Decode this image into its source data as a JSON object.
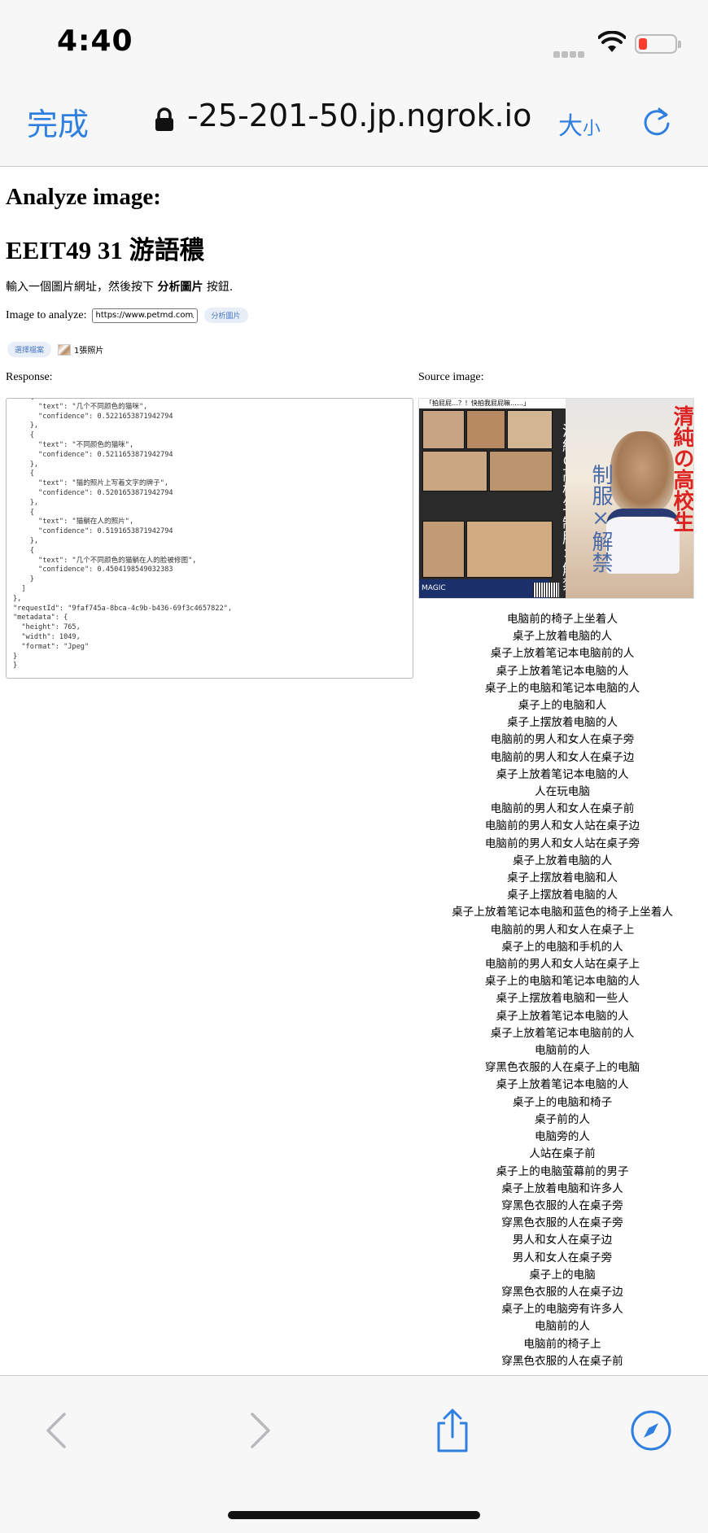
{
  "status_bar": {
    "time": "4:40"
  },
  "browser": {
    "done_label": "完成",
    "url": "-25-201-50.jp.ngrok.io",
    "text_size_big": "大",
    "text_size_small": "小"
  },
  "page": {
    "heading": "Analyze image:",
    "student": "EEIT49 31 游語穠",
    "intro_prefix": "輸入一個圖片網址，然後按下 ",
    "intro_bold": "分析圖片",
    "intro_suffix": " 按鈕.",
    "image_label": "Image to analyze:",
    "url_value": "https://www.petmd.com/sites/default/files/",
    "analyze_button": "分析圖片",
    "choose_file_button": "選擇檔案",
    "file_count": "1張照片",
    "response_label": "Response:",
    "source_label": "Source image:"
  },
  "response_json": [
    "    {",
    "      \"text\": \"几个不同颜色的猫咪\",",
    "      \"confidence\": 0.5221653871942794",
    "    },",
    "    {",
    "      \"text\": \"不同颜色的猫咪\",",
    "      \"confidence\": 0.5211653871942794",
    "    },",
    "    {",
    "      \"text\": \"猫的照片上写着文字的牌子\",",
    "      \"confidence\": 0.5201653871942794",
    "    },",
    "    {",
    "      \"text\": \"猫躺在人的照片\",",
    "      \"confidence\": 0.5191653871942794",
    "    },",
    "    {",
    "      \"text\": \"几个不同颜色的猫躺在人的脸被修图\",",
    "      \"confidence\": 0.4504198549032383",
    "    }",
    "  ]",
    "},",
    "\"requestId\": \"9faf745a-8bca-4c9b-b436-69f3c4657822\",",
    "\"metadata\": {",
    "  \"height\": 765,",
    "  \"width\": 1049,",
    "  \"format\": \"Jpeg\"",
    "}",
    "}"
  ],
  "poster_text": {
    "top_strip": "「拍屁屁…？！快拍我屁屁嘛……」",
    "vertical_white": "清純の高校生 制服×解禁",
    "red_title": "清純の高校生",
    "blue_title": "制服×解禁",
    "brand": "MAGIC"
  },
  "captions": [
    "电脑前的椅子上坐着人",
    "桌子上放着电脑的人",
    "桌子上放着笔记本电脑前的人",
    "桌子上放着笔记本电脑的人",
    "桌子上的电脑和笔记本电脑的人",
    "桌子上的电脑和人",
    "桌子上摆放着电脑的人",
    "电脑前的男人和女人在桌子旁",
    "电脑前的男人和女人在桌子边",
    "桌子上放着笔记本电脑的人",
    "人在玩电脑",
    "电脑前的男人和女人在桌子前",
    "电脑前的男人和女人站在桌子边",
    "电脑前的男人和女人站在桌子旁",
    "桌子上放着电脑的人",
    "桌子上摆放着电脑和人",
    "桌子上摆放着电脑的人",
    "桌子上放着笔记本电脑和蓝色的椅子上坐着人",
    "电脑前的男人和女人在桌子上",
    "桌子上的电脑和手机的人",
    "电脑前的男人和女人站在桌子上",
    "桌子上的电脑和笔记本电脑的人",
    "桌子上摆放着电脑和一些人",
    "桌子上放着笔记本电脑的人",
    "桌子上放着笔记本电脑前的人",
    "电脑前的人",
    "穿黑色衣服的人在桌子上的电脑",
    "桌子上放着笔记本电脑的人",
    "桌子上的电脑和椅子",
    "桌子前的人",
    "电脑旁的人",
    "人站在桌子前",
    "桌子上的电脑萤幕前的男子",
    "桌子上放着电脑和许多人",
    "穿黑色衣服的人在桌子旁",
    "穿黑色衣服的人在桌子旁",
    "男人和女人在桌子边",
    "男人和女人在桌子旁",
    "桌子上的电脑",
    "穿黑色衣服的人在桌子边",
    "桌子上的电脑旁有许多人",
    "电脑前的人",
    "电脑前的椅子上",
    "穿黑色衣服的人在桌子前"
  ]
}
